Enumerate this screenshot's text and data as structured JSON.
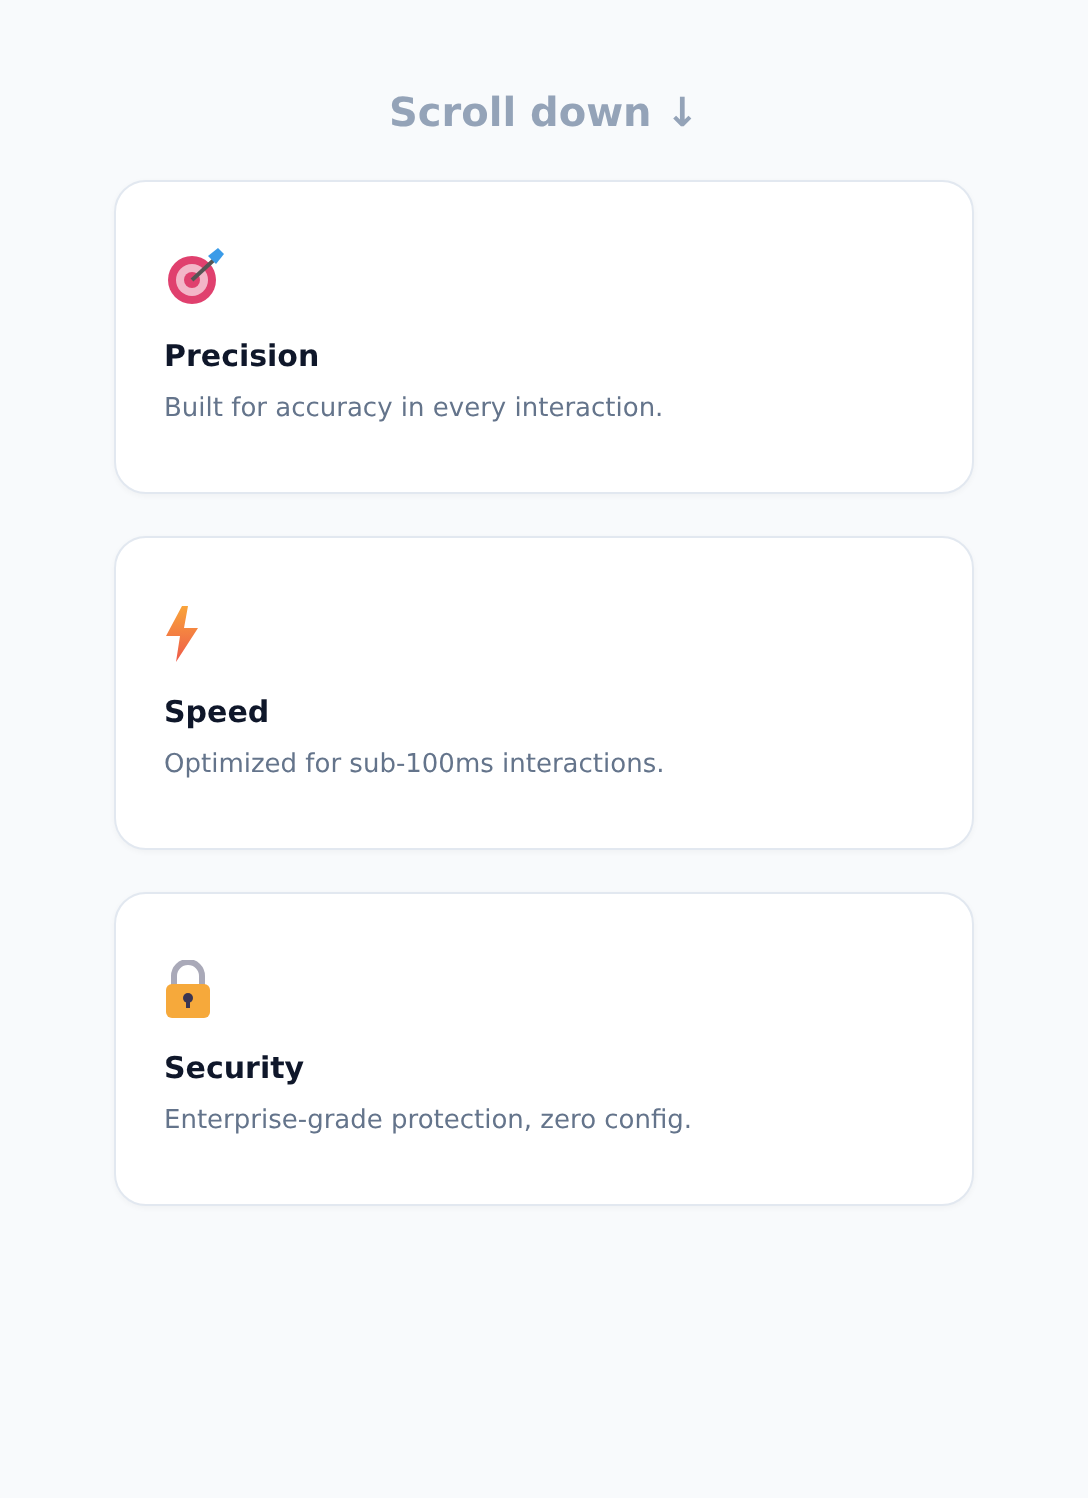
{
  "heading": "Scroll down ↓",
  "cards": [
    {
      "kind": "target",
      "title": "Precision",
      "text": "Built for accuracy in every interaction."
    },
    {
      "kind": "bolt",
      "title": "Speed",
      "text": "Optimized for sub-100ms interactions."
    },
    {
      "kind": "lock",
      "title": "Security",
      "text": "Enterprise-grade protection, zero config."
    }
  ]
}
